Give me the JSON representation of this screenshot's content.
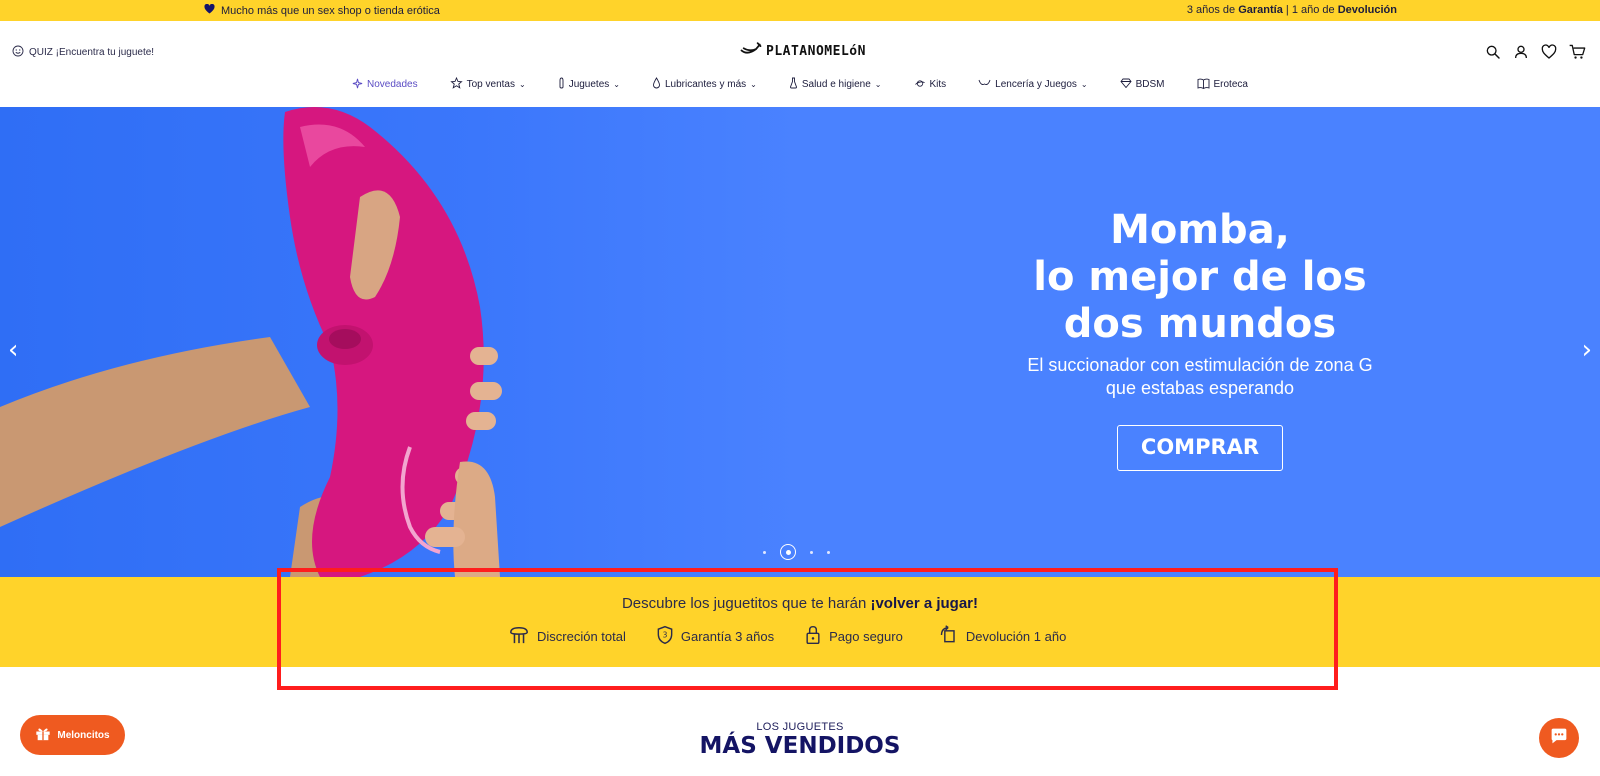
{
  "topbar": {
    "left_text": "Mucho más que un sex shop o tienda erótica",
    "right_pre": "3 años de ",
    "right_b1": "Garantía",
    "right_mid": " | 1 año de ",
    "right_b2": "Devolución"
  },
  "header": {
    "quiz_label": "QUIZ ¡Encuentra tu juguete!",
    "logo_text": "PLATANOMELóN",
    "icons": [
      "search-icon",
      "account-icon",
      "wishlist-heart-icon",
      "cart-icon"
    ]
  },
  "nav": {
    "items": [
      {
        "label": "Novedades",
        "icon": "sparkle-icon",
        "dropdown": false,
        "active": true
      },
      {
        "label": "Top ventas",
        "icon": "star-icon",
        "dropdown": true
      },
      {
        "label": "Juguetes",
        "icon": "toy-icon",
        "dropdown": true
      },
      {
        "label": "Lubricantes y más",
        "icon": "drop-icon",
        "dropdown": true
      },
      {
        "label": "Salud e higiene",
        "icon": "flask-icon",
        "dropdown": true
      },
      {
        "label": "Kits",
        "icon": "kit-icon",
        "dropdown": false
      },
      {
        "label": "Lencería y Juegos",
        "icon": "lingerie-icon",
        "dropdown": true
      },
      {
        "label": "BDSM",
        "icon": "gem-icon",
        "dropdown": false
      },
      {
        "label": "Eroteca",
        "icon": "book-icon",
        "dropdown": false
      }
    ]
  },
  "hero": {
    "title": "Momba,\nlo mejor de los\ndos mundos",
    "subtitle": "El succionador con estimulación de zona G\nque estabas esperando",
    "cta_label": "COMPRAR",
    "slide_count": 4,
    "active_slide": 1
  },
  "band": {
    "title_pre": "Descubre los juguetitos que te harán ",
    "title_bold": "¡volver a jugar!",
    "benefits": [
      {
        "label": "Discreción total",
        "icon": "discretion-icon"
      },
      {
        "label": "Garantía 3 años",
        "icon": "shield-icon"
      },
      {
        "label": "Pago seguro",
        "icon": "lock-icon"
      },
      {
        "label": "Devolución 1 año",
        "icon": "return-icon"
      }
    ]
  },
  "section": {
    "kicker": "LOS JUGUETES",
    "title": "MÁS VENDIDOS"
  },
  "widgets": {
    "rewards_label": "Meloncitos"
  },
  "colors": {
    "yellow": "#ffd32a",
    "hero_blue": "#4a82ff",
    "navy": "#141464",
    "orange": "#ef5a20",
    "highlight_red": "#ff1d1d"
  }
}
